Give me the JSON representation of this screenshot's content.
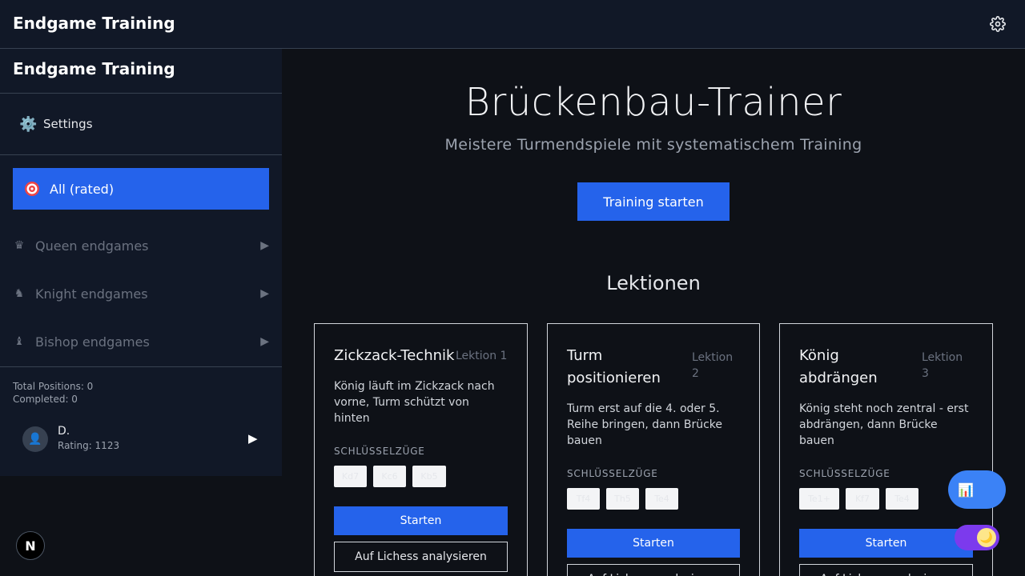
{
  "topbar": {
    "title": "Endgame Training",
    "settings_icon": "gear-icon"
  },
  "sidebar": {
    "title": "Endgame Training",
    "settings_label": "Settings",
    "settings_icon": "⚙️",
    "active_item": {
      "label": "All (rated)",
      "icon": "target-icon"
    },
    "categories": [
      {
        "label": "Queen endgames",
        "icon": "♛",
        "arrow": "▶"
      },
      {
        "label": "Knight endgames",
        "icon": "♞",
        "arrow": "▶"
      },
      {
        "label": "Bishop endgames",
        "icon": "♝",
        "arrow": "▶"
      }
    ],
    "stats": {
      "total": "Total Positions: 0",
      "completed": "Completed: 0"
    },
    "user": {
      "name": "D.",
      "rating": "Rating: 1123",
      "avatar_icon": "👤",
      "play_icon": "▶"
    }
  },
  "main": {
    "title": "Brückenbau-Trainer",
    "subtitle": "Meistere Turmendspiele mit systematischem Training",
    "start_button": "Training starten",
    "lessons_heading": "Lektionen",
    "cards": [
      {
        "title": "Zickzack-Technik",
        "lesson": "Lektion 1",
        "description": "König läuft im Zickzack nach vorne, Turm schützt von hinten",
        "key_moves_label": "SCHLÜSSELZÜGE",
        "chips": [
          "Kd7",
          "Kc6",
          "Kb5"
        ],
        "start_label": "Starten",
        "lichess_label": "Auf Lichess analysieren"
      },
      {
        "title": "Turm positionieren",
        "lesson": "Lektion 2",
        "description": "Turm erst auf die 4. oder 5. Reihe bringen, dann Brücke bauen",
        "key_moves_label": "SCHLÜSSELZÜGE",
        "chips": [
          "Tf4",
          "Th5",
          "Te4"
        ],
        "start_label": "Starten",
        "lichess_label": "Auf Lichess analysieren"
      },
      {
        "title": "König abdrängen",
        "lesson": "Lektion 3",
        "description": "König steht noch zentral - erst abdrängen, dann Brücke bauen",
        "key_moves_label": "SCHLÜSSELZÜGE",
        "chips": [
          "Te1+",
          "Kf7",
          "Te4"
        ],
        "start_label": "Starten",
        "lichess_label": "Auf Lichess analysieren"
      }
    ]
  },
  "floating": {
    "stats_icon": "📊",
    "theme_icon": "🌙",
    "next_badge": "N"
  },
  "colors": {
    "accent": "#2563eb",
    "background": "#0e1117",
    "sidebar": "#111827"
  }
}
